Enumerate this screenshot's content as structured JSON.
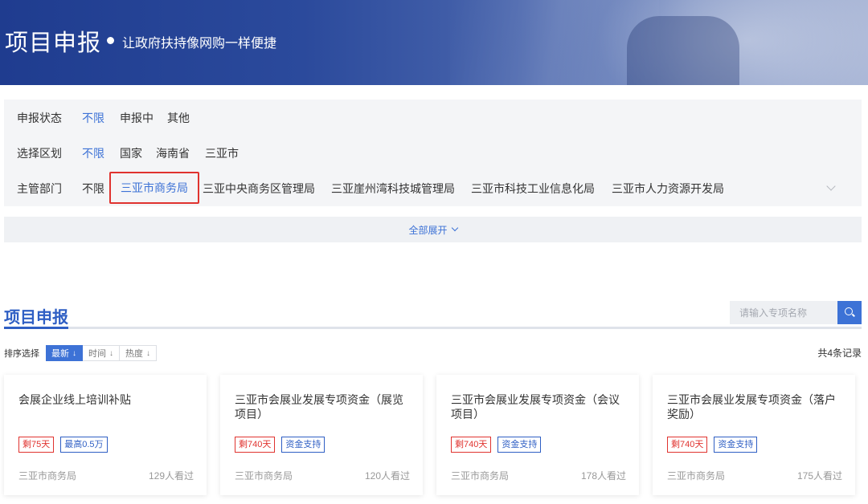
{
  "banner": {
    "title": "项目申报",
    "slogan": "让政府扶持像网购一样便捷"
  },
  "filters": {
    "status": {
      "label": "申报状态",
      "options": [
        "不限",
        "申报中",
        "其他"
      ],
      "active": "不限"
    },
    "region": {
      "label": "选择区划",
      "options": [
        "不限",
        "国家",
        "海南省",
        "三亚市"
      ],
      "active": "不限"
    },
    "department": {
      "label": "主管部门",
      "options": [
        "不限",
        "三亚市商务局",
        "三亚中央商务区管理局",
        "三亚崖州湾科技城管理局",
        "三亚市科技工业信息化局",
        "三亚市人力资源开发局"
      ],
      "selected": "三亚市商务局"
    },
    "expand_label": "全部展开"
  },
  "section": {
    "title": "项目申报",
    "search_placeholder": "请输入专项名称",
    "sort_label": "排序选择",
    "sort_options": [
      {
        "label": "最新",
        "arrow": "↓",
        "active": true
      },
      {
        "label": "时间",
        "arrow": "↓",
        "active": false
      },
      {
        "label": "热度",
        "arrow": "↓",
        "active": false
      }
    ],
    "total": "共4条记录"
  },
  "cards": [
    {
      "title": "会展企业线上培训补贴",
      "tags": [
        {
          "text": "剩75天",
          "color": "red"
        },
        {
          "text": "最高0.5万",
          "color": "blue"
        }
      ],
      "dept": "三亚市商务局",
      "views": "129人看过"
    },
    {
      "title": "三亚市会展业发展专项资金（展览项目）",
      "tags": [
        {
          "text": "剩740天",
          "color": "red"
        },
        {
          "text": "资金支持",
          "color": "blue"
        }
      ],
      "dept": "三亚市商务局",
      "views": "120人看过"
    },
    {
      "title": "三亚市会展业发展专项资金（会议项目）",
      "tags": [
        {
          "text": "剩740天",
          "color": "red"
        },
        {
          "text": "资金支持",
          "color": "blue"
        }
      ],
      "dept": "三亚市商务局",
      "views": "178人看过"
    },
    {
      "title": "三亚市会展业发展专项资金（落户奖励）",
      "tags": [
        {
          "text": "剩740天",
          "color": "red"
        },
        {
          "text": "资金支持",
          "color": "blue"
        }
      ],
      "dept": "三亚市商务局",
      "views": "175人看过"
    }
  ],
  "colors": {
    "accent": "#3d72d6",
    "highlight_border": "#e0332f",
    "tag_red": "#e0332f",
    "tag_blue": "#2f5fc4"
  },
  "icons": {
    "search": "search-icon",
    "expand": "chevron-down-icon"
  }
}
